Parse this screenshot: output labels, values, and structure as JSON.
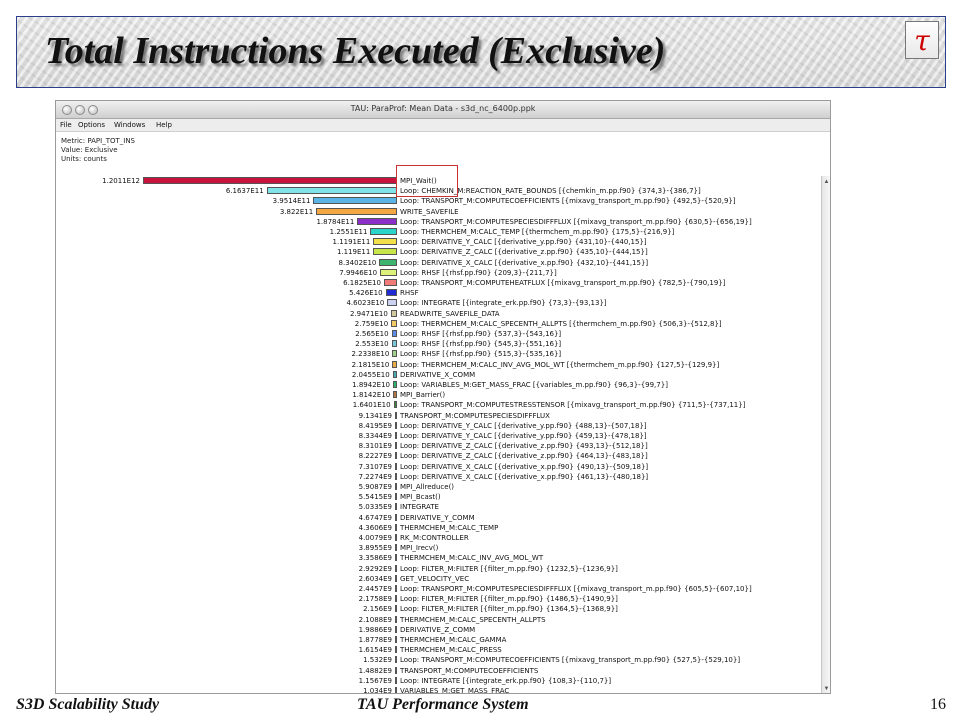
{
  "slide": {
    "title": "Total Instructions Executed (Exclusive)",
    "logo_text": "τ",
    "footer_left": "S3D Scalability Study",
    "footer_center": "TAU Performance System",
    "page_number": "16"
  },
  "window": {
    "title": "TAU: ParaProf: Mean Data - s3d_nc_6400p.ppk",
    "menu": [
      "File",
      "Options",
      "Windows",
      "Help"
    ],
    "metric": "Metric: PAPI_TOT_INS",
    "value": "Value: Exclusive",
    "units": "Units: counts"
  },
  "rows": [
    {
      "value_label": "1.2011E12",
      "value": 1201100000000.0,
      "label": "MPI_Wait()",
      "color": "#c8143c"
    },
    {
      "value_label": "6.1637E11",
      "value": 616370000000.0,
      "label": "Loop: CHEMKIN_M:REACTION_RATE_BOUNDS [{chemkin_m.pp.f90} {374,3}-{386,7}]",
      "color": "#7fe3e8"
    },
    {
      "value_label": "3.9514E11",
      "value": 395140000000.0,
      "label": "Loop: TRANSPORT_M:COMPUTECOEFFICIENTS [{mixavg_transport_m.pp.f90} {492,5}-{520,9}]",
      "color": "#5ab4e6"
    },
    {
      "value_label": "3.822E11",
      "value": 382200000000.0,
      "label": "WRITE_SAVEFILE",
      "color": "#f4a640"
    },
    {
      "value_label": "1.8784E11",
      "value": 187840000000.0,
      "label": "Loop: TRANSPORT_M:COMPUTESPECIESDIFFFLUX [{mixavg_transport_m.pp.f90} {630,5}-{656,19}]",
      "color": "#8c2fc8"
    },
    {
      "value_label": "1.2551E11",
      "value": 125510000000.0,
      "label": "Loop: THERMCHEM_M:CALC_TEMP [{thermchem_m.pp.f90} {175,5}-{216,9}]",
      "color": "#2ad4c8"
    },
    {
      "value_label": "1.1191E11",
      "value": 111910000000.0,
      "label": "Loop: DERIVATIVE_Y_CALC [{derivative_y.pp.f90} {431,10}-{440,15}]",
      "color": "#f2e04a"
    },
    {
      "value_label": "1.119E11",
      "value": 111900000000.0,
      "label": "Loop: DERIVATIVE_Z_CALC [{derivative_z.pp.f90} {435,10}-{444,15}]",
      "color": "#c8e64a"
    },
    {
      "value_label": "8.3402E10",
      "value": 83402000000.0,
      "label": "Loop: DERIVATIVE_X_CALC [{derivative_x.pp.f90} {432,10}-{441,15}]",
      "color": "#3cb46e"
    },
    {
      "value_label": "7.9946E10",
      "value": 79946000000.0,
      "label": "Loop: RHSF [{rhsf.pp.f90} {209,3}-{211,7}]",
      "color": "#dcf07a"
    },
    {
      "value_label": "6.1825E10",
      "value": 61825000000.0,
      "label": "Loop: TRANSPORT_M:COMPUTEHEATFLUX [{mixavg_transport_m.pp.f90} {782,5}-{790,19}]",
      "color": "#f07a78"
    },
    {
      "value_label": "5.426E10",
      "value": 54260000000.0,
      "label": "RHSF",
      "color": "#1e2ad2"
    },
    {
      "value_label": "4.6023E10",
      "value": 46023000000.0,
      "label": "Loop: INTEGRATE [{integrate_erk.pp.f90} {73,3}-{93,13}]",
      "color": "#c8d2f0"
    },
    {
      "value_label": "2.9471E10",
      "value": 29471000000.0,
      "label": "READWRITE_SAVEFILE_DATA",
      "color": "#d2c8a0"
    },
    {
      "value_label": "2.759E10",
      "value": 27590000000.0,
      "label": "Loop: THERMCHEM_M:CALC_SPECENTH_ALLPTS [{thermchem_m.pp.f90} {506,3}-{512,8}]",
      "color": "#f0c864"
    },
    {
      "value_label": "2.565E10",
      "value": 25650000000.0,
      "label": "Loop: RHSF [{rhsf.pp.f90} {537,3}-{543,16}]",
      "color": "#5a8ce6"
    },
    {
      "value_label": "2.553E10",
      "value": 25530000000.0,
      "label": "Loop: RHSF [{rhsf.pp.f90} {545,3}-{551,16}]",
      "color": "#78c8dc"
    },
    {
      "value_label": "2.2338E10",
      "value": 22338000000.0,
      "label": "Loop: RHSF [{rhsf.pp.f90} {515,3}-{535,16}]",
      "color": "#a0d28c"
    },
    {
      "value_label": "2.1815E10",
      "value": 21815000000.0,
      "label": "Loop: THERMCHEM_M:CALC_INV_AVG_MOL_WT [{thermchem_m.pp.f90} {127,5}-{129,9}]",
      "color": "#e6aa46"
    },
    {
      "value_label": "2.0455E10",
      "value": 20455000000.0,
      "label": "DERIVATIVE_X_COMM",
      "color": "#46aab4"
    },
    {
      "value_label": "1.8942E10",
      "value": 18942000000.0,
      "label": "Loop: VARIABLES_M:GET_MASS_FRAC [{variables_m.pp.f90} {96,3}-{99,7}]",
      "color": "#28b46e"
    },
    {
      "value_label": "1.8142E10",
      "value": 18142000000.0,
      "label": "MPI_Barrier()",
      "color": "#b47846"
    },
    {
      "value_label": "1.6401E10",
      "value": 16401000000.0,
      "label": "Loop: TRANSPORT_M:COMPUTESTRESSTENSOR [{mixavg_transport_m.pp.f90} {711,5}-{737,11}]",
      "color": "#3c8c3c"
    },
    {
      "value_label": "9.1341E9",
      "value": 9134100000.0,
      "label": "TRANSPORT_M:COMPUTESPECIESDIFFFLUX",
      "color": "#6e3cb4"
    },
    {
      "value_label": "8.4195E9",
      "value": 8419500000.0,
      "label": "Loop: DERIVATIVE_Y_CALC [{derivative_y.pp.f90} {488,13}-{507,18}]",
      "color": "#46966e"
    },
    {
      "value_label": "8.3344E9",
      "value": 8334400000.0,
      "label": "Loop: DERIVATIVE_Y_CALC [{derivative_y.pp.f90} {459,13}-{478,18}]",
      "color": "#966e46"
    },
    {
      "value_label": "8.3101E9",
      "value": 8310100000.0,
      "label": "Loop: DERIVATIVE_Z_CALC [{derivative_z.pp.f90} {493,13}-{512,18}]",
      "color": "#46a0c8"
    },
    {
      "value_label": "8.2227E9",
      "value": 8222700000.0,
      "label": "Loop: DERIVATIVE_Z_CALC [{derivative_z.pp.f90} {464,13}-{483,18}]",
      "color": "#8cbe50"
    },
    {
      "value_label": "7.3107E9",
      "value": 7310700000.0,
      "label": "Loop: DERIVATIVE_X_CALC [{derivative_x.pp.f90} {490,13}-{509,18}]",
      "color": "#c88c3c"
    },
    {
      "value_label": "7.2274E9",
      "value": 7227400000.0,
      "label": "Loop: DERIVATIVE_X_CALC [{derivative_x.pp.f90} {461,13}-{480,18}]",
      "color": "#3c78b4"
    },
    {
      "value_label": "5.9087E9",
      "value": 5908700000.0,
      "label": "MPI_Allreduce()",
      "color": "#888888"
    },
    {
      "value_label": "5.5415E9",
      "value": 5541500000.0,
      "label": "MPI_Bcast()",
      "color": "#888888"
    },
    {
      "value_label": "5.0335E9",
      "value": 5033500000.0,
      "label": "INTEGRATE",
      "color": "#888888"
    },
    {
      "value_label": "4.6747E9",
      "value": 4674700000.0,
      "label": "DERIVATIVE_Y_COMM",
      "color": "#888888"
    },
    {
      "value_label": "4.3606E9",
      "value": 4360600000.0,
      "label": "THERMCHEM_M:CALC_TEMP",
      "color": "#888888"
    },
    {
      "value_label": "4.0079E9",
      "value": 4007900000.0,
      "label": "RK_M:CONTROLLER",
      "color": "#888888"
    },
    {
      "value_label": "3.8955E9",
      "value": 3895500000.0,
      "label": "MPI_Irecv()",
      "color": "#888888"
    },
    {
      "value_label": "3.3586E9",
      "value": 3358600000.0,
      "label": "THERMCHEM_M:CALC_INV_AVG_MOL_WT",
      "color": "#888888"
    },
    {
      "value_label": "2.9292E9",
      "value": 2929200000.0,
      "label": "Loop: FILTER_M:FILTER [{filter_m.pp.f90} {1232,5}-{1236,9}]",
      "color": "#888888"
    },
    {
      "value_label": "2.6034E9",
      "value": 2603400000.0,
      "label": "GET_VELOCITY_VEC",
      "color": "#888888"
    },
    {
      "value_label": "2.4457E9",
      "value": 2445700000.0,
      "label": "Loop: TRANSPORT_M:COMPUTESPECIESDIFFFLUX [{mixavg_transport_m.pp.f90} {605,5}-{607,10}]",
      "color": "#888888"
    },
    {
      "value_label": "2.1758E9",
      "value": 2175800000.0,
      "label": "Loop: FILTER_M:FILTER [{filter_m.pp.f90} {1486,5}-{1490,9}]",
      "color": "#888888"
    },
    {
      "value_label": "2.156E9",
      "value": 2156000000.0,
      "label": "Loop: FILTER_M:FILTER [{filter_m.pp.f90} {1364,5}-{1368,9}]",
      "color": "#888888"
    },
    {
      "value_label": "2.1088E9",
      "value": 2108800000.0,
      "label": "THERMCHEM_M:CALC_SPECENTH_ALLPTS",
      "color": "#888888"
    },
    {
      "value_label": "1.9886E9",
      "value": 1988600000.0,
      "label": "DERIVATIVE_Z_COMM",
      "color": "#888888"
    },
    {
      "value_label": "1.8778E9",
      "value": 1877800000.0,
      "label": "THERMCHEM_M:CALC_GAMMA",
      "color": "#888888"
    },
    {
      "value_label": "1.6154E9",
      "value": 1615400000.0,
      "label": "THERMCHEM_M:CALC_PRESS",
      "color": "#888888"
    },
    {
      "value_label": "1.532E9",
      "value": 1532000000.0,
      "label": "Loop: TRANSPORT_M:COMPUTECOEFFICIENTS [{mixavg_transport_m.pp.f90} {527,5}-{529,10}]",
      "color": "#888888"
    },
    {
      "value_label": "1.4882E9",
      "value": 1488200000.0,
      "label": "TRANSPORT_M:COMPUTECOEFFICIENTS",
      "color": "#888888"
    },
    {
      "value_label": "1.1567E9",
      "value": 1156700000.0,
      "label": "Loop: INTEGRATE [{integrate_erk.pp.f90} {108,3}-{110,7}]",
      "color": "#888888"
    },
    {
      "value_label": "1.034E9",
      "value": 1034000000.0,
      "label": "VARIABLES_M:GET_MASS_FRAC",
      "color": "#888888"
    }
  ]
}
